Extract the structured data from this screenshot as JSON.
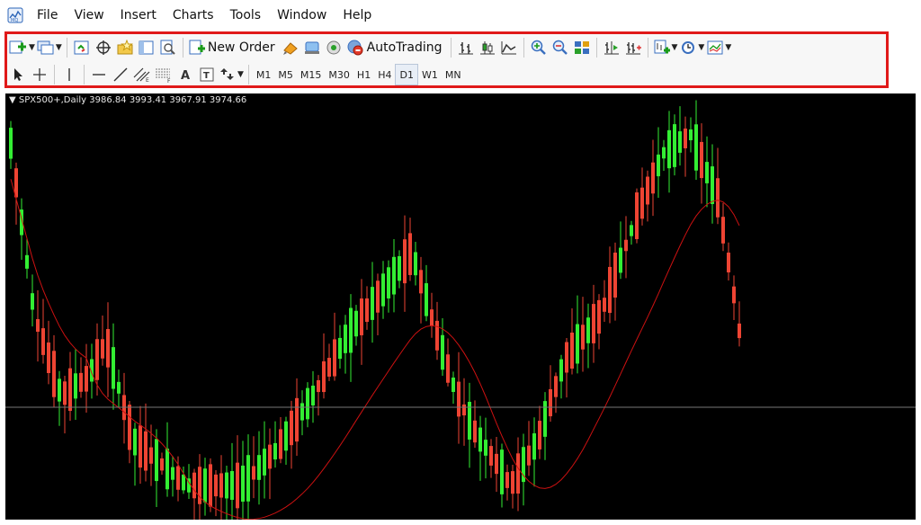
{
  "menu": [
    "File",
    "View",
    "Insert",
    "Charts",
    "Tools",
    "Window",
    "Help"
  ],
  "toolbar": {
    "new_order_label": "New Order",
    "autotrading_label": "AutoTrading",
    "timeframes": [
      "M1",
      "M5",
      "M15",
      "M30",
      "H1",
      "H4",
      "D1",
      "W1",
      "MN"
    ],
    "active_timeframe": "D1"
  },
  "chart": {
    "symbol_label": "SPX500+,Daily",
    "open": "3986.84",
    "high": "3993.41",
    "low": "3967.91",
    "close": "3974.66",
    "background": "#000000",
    "bull_color": "#33ee33",
    "bear_color": "#ee4433",
    "ma_color": "#cc1111",
    "crosshair_color": "#777777"
  },
  "highlight_color": "#e01919"
}
